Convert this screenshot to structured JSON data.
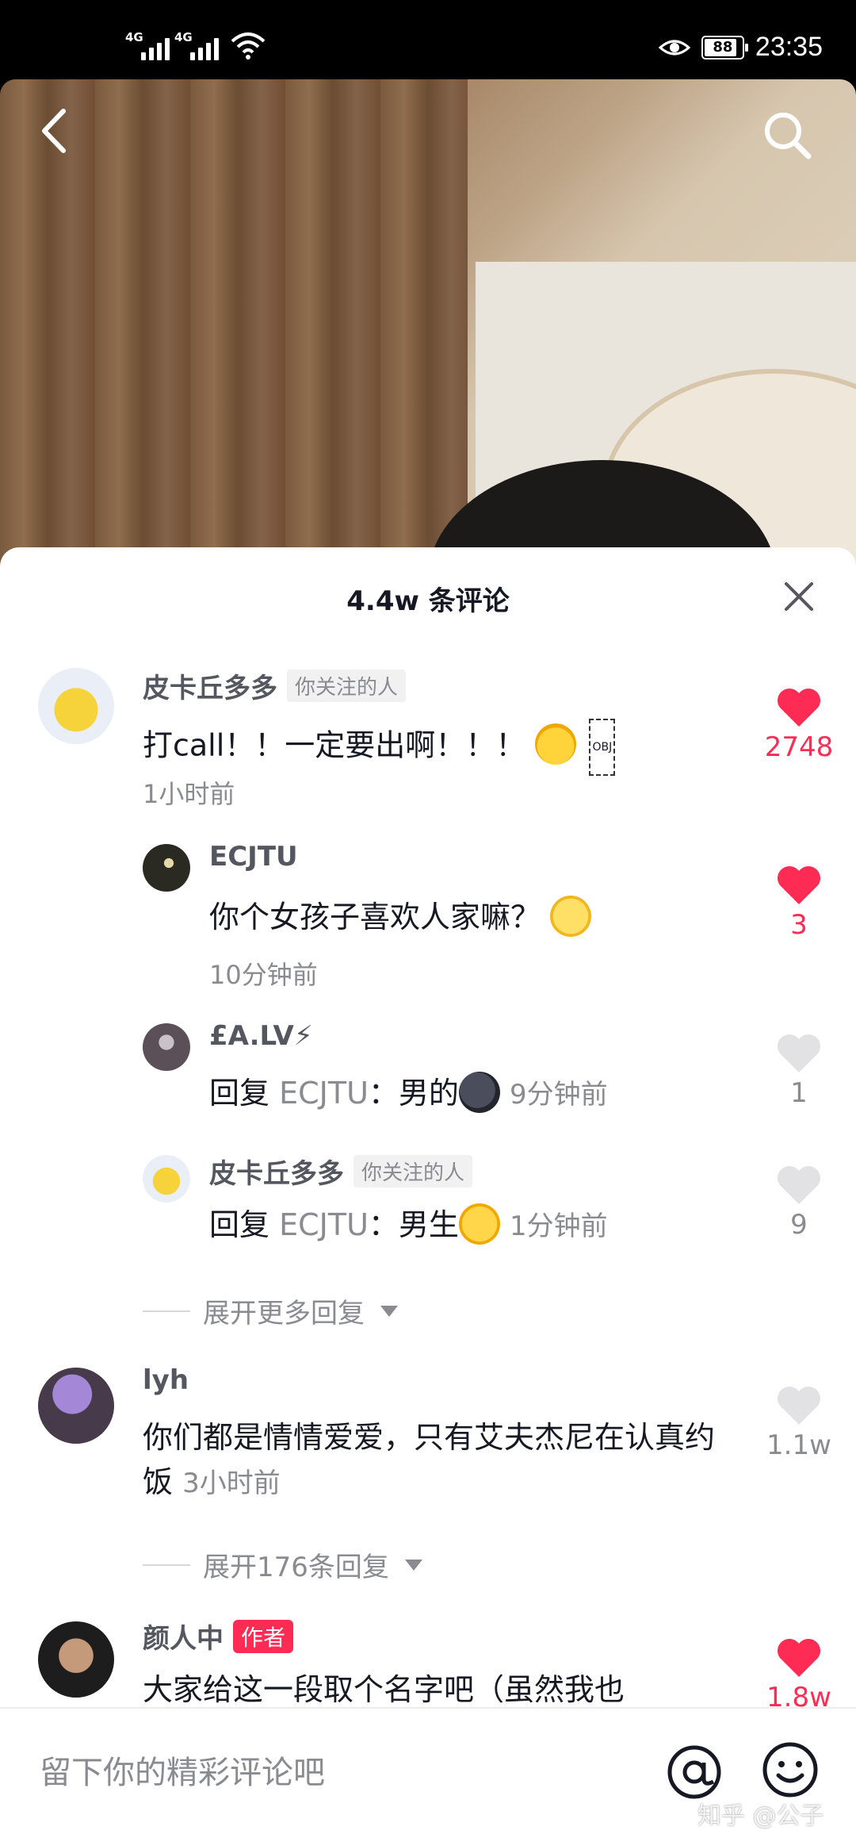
{
  "status_bar": {
    "sim1": "4G",
    "sim2": "4G",
    "battery": "88",
    "battery_level_percent": 88,
    "time": "23:35"
  },
  "video": {
    "back_icon": "chevron-left-icon",
    "search_icon": "search-icon"
  },
  "sheet": {
    "title": "4.4w 条评论",
    "close_icon": "close-icon"
  },
  "colors": {
    "accent": "#fe2c55",
    "secondary_text": "#8a8b91"
  },
  "comments": [
    {
      "name": "皮卡丘多多",
      "tag": "你关注的人",
      "text": "打call！！一定要出啊！！！",
      "obj": "OBJ",
      "time": "1小时前",
      "likes": "2748",
      "liked": true,
      "replies": [
        {
          "name": "ECJTU",
          "text": "你个女孩子喜欢人家嘛？",
          "time": "10分钟前",
          "likes": "3",
          "liked": true
        },
        {
          "name": "£A.LV⚡",
          "reply_prefix": "回复",
          "reply_to": "ECJTU",
          "text": "：男的",
          "time": "9分钟前",
          "likes": "1",
          "liked": false
        },
        {
          "name": "皮卡丘多多",
          "tag": "你关注的人",
          "reply_prefix": "回复",
          "reply_to": "ECJTU",
          "text": "：男生",
          "time": "1分钟前",
          "likes": "9",
          "liked": false
        }
      ],
      "expand": "展开更多回复"
    },
    {
      "name": "lyh",
      "text": "你们都是情情爱爱，只有艾夫杰尼在认真约饭",
      "time": "3小时前",
      "likes": "1.1w",
      "liked": false,
      "expand": "展开176条回复"
    },
    {
      "name": "颜人中",
      "tag": "作者",
      "text": "大家给这一段取个名字吧（虽然我也",
      "likes": "1.8w",
      "liked": true
    }
  ],
  "input": {
    "placeholder": "留下你的精彩评论吧",
    "at_icon": "at-icon",
    "emoji_icon": "emoji-icon"
  },
  "watermark": "知乎 @公子"
}
